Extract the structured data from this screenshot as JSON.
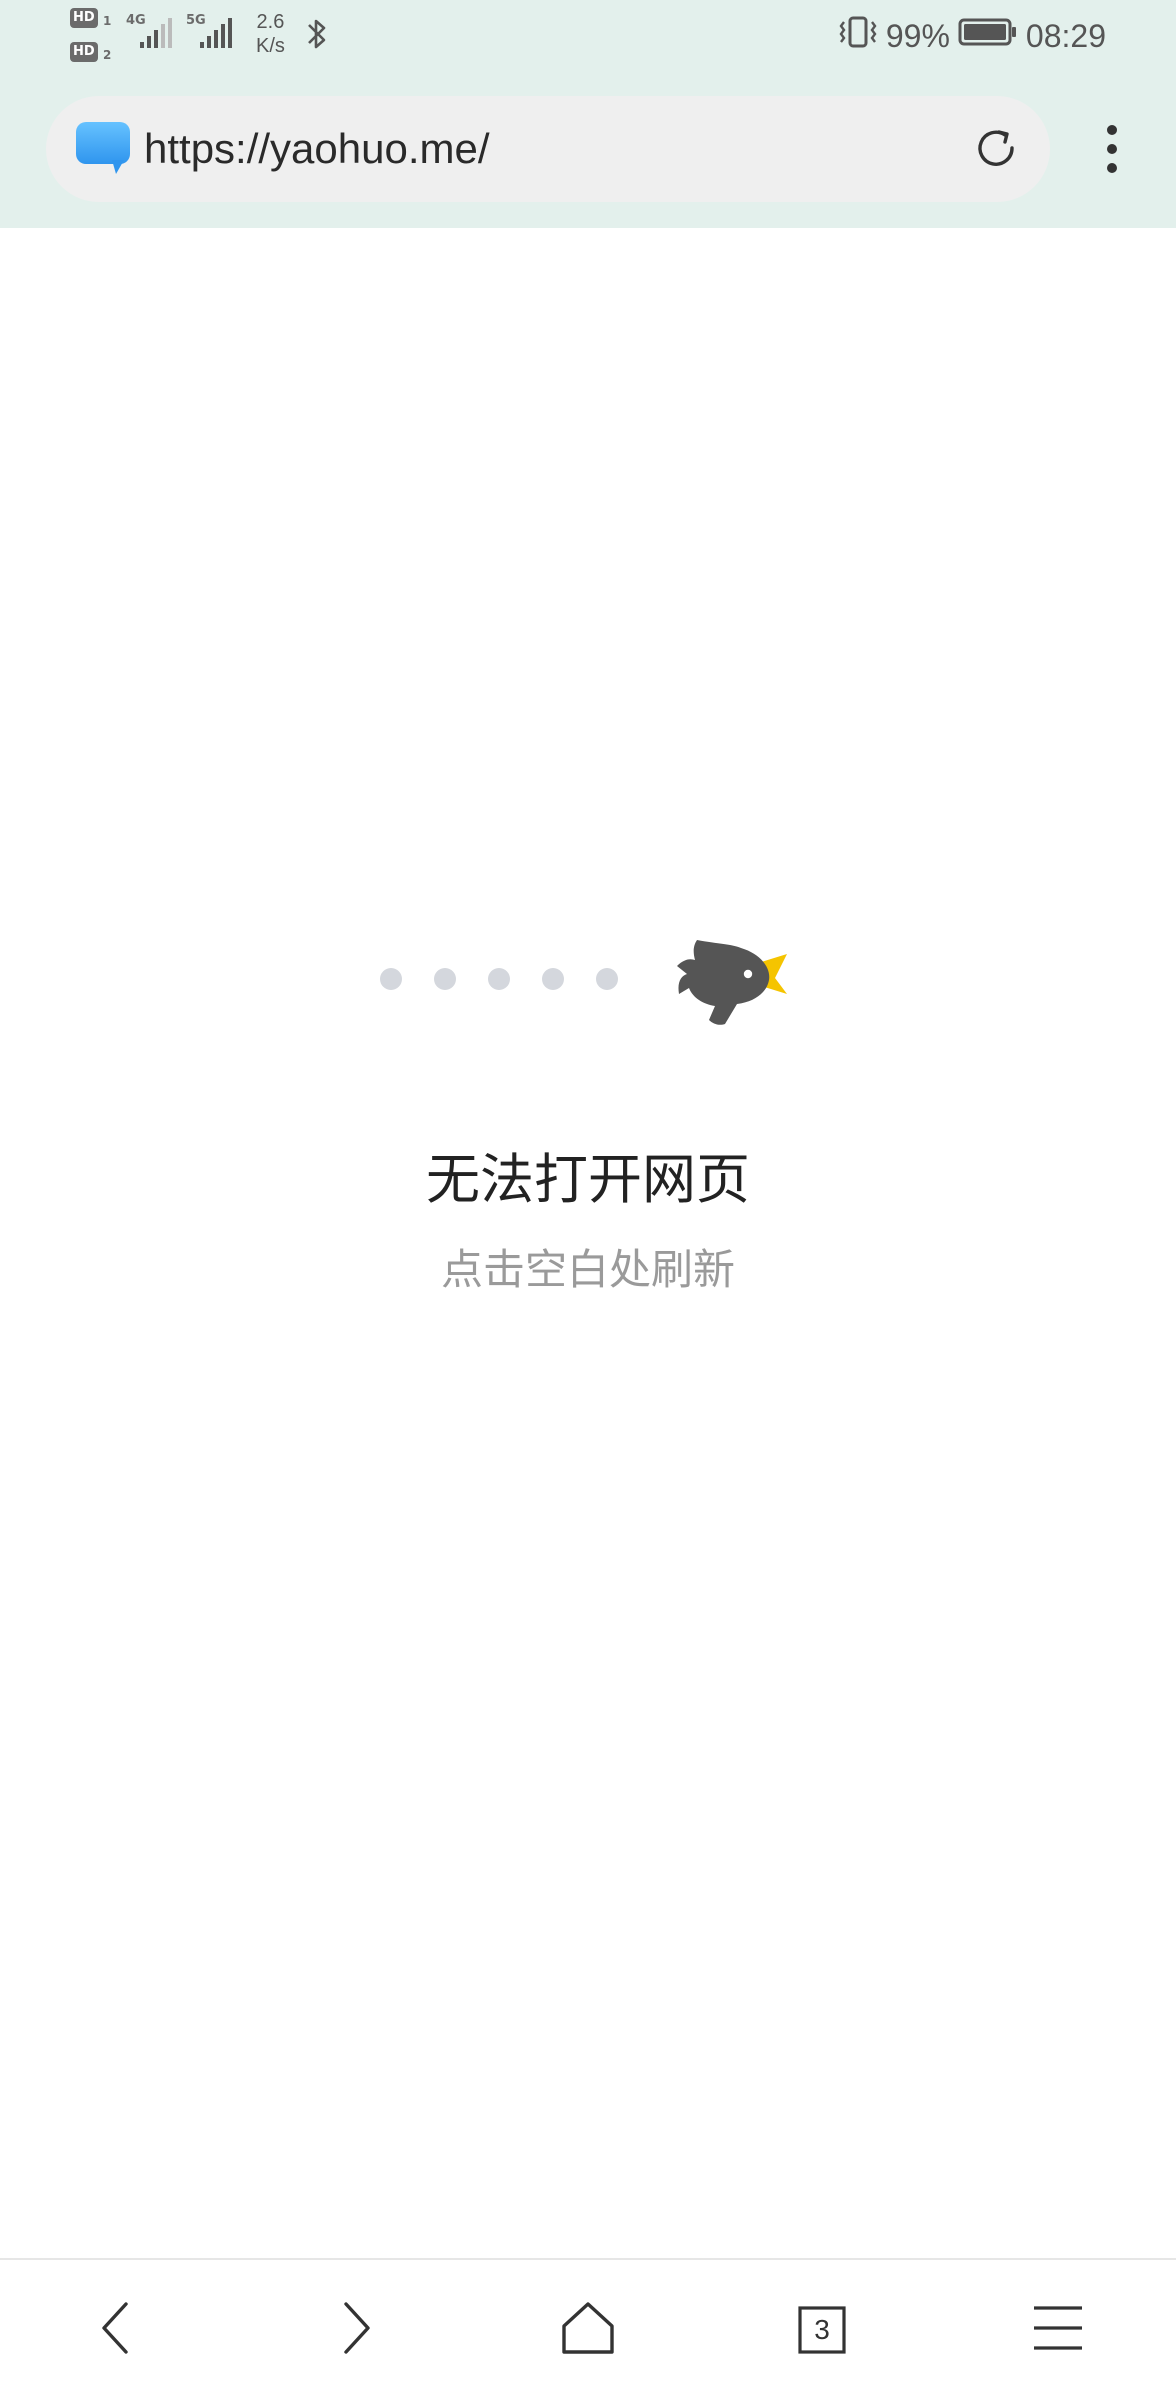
{
  "status_bar": {
    "sim1_label": "HD",
    "sim1_index": "1",
    "sim2_label": "HD",
    "sim2_index": "2",
    "sig1_tech": "4G",
    "sig2_tech": "5G",
    "net_speed_value": "2.6",
    "net_speed_unit": "K/s",
    "battery_percent": "99%",
    "time": "08:29",
    "icons": [
      "signal-icon",
      "bluetooth-icon",
      "vibrate-icon",
      "battery-icon"
    ]
  },
  "address_bar": {
    "url": "https://yaohuo.me/",
    "site_icon": "chat-bubble-icon",
    "reload_icon": "reload-icon",
    "menu_icon": "more-vert-icon"
  },
  "error_page": {
    "title": "无法打开网页",
    "subtitle": "点击空白处刷新",
    "illustration": "bird-icon",
    "dot_color": "#d4d7dd",
    "bird_color": "#555555",
    "beak_color": "#f5c400"
  },
  "bottom_nav": {
    "tab_count": "3",
    "icons": [
      "back-icon",
      "forward-icon",
      "home-icon",
      "tabs-icon",
      "menu-icon"
    ]
  },
  "colors": {
    "top_bg": "#e3f0ec",
    "url_bar_bg": "#efefef"
  }
}
